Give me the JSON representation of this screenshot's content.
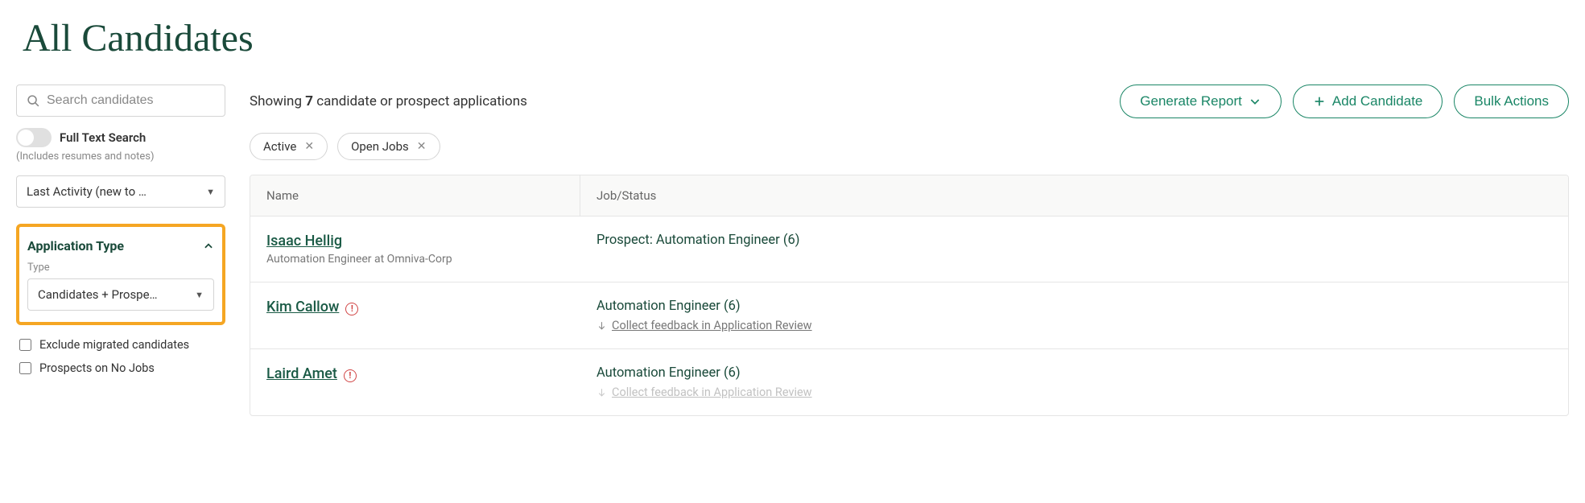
{
  "page_title": "All Candidates",
  "search_placeholder": "Search candidates",
  "full_text_search": {
    "label": "Full Text Search",
    "hint": "(Includes resumes and notes)"
  },
  "sort_select": "Last Activity (new to …",
  "application_type": {
    "header": "Application Type",
    "type_label": "Type",
    "type_value": "Candidates + Prospe…"
  },
  "checkboxes": {
    "exclude_migrated": "Exclude migrated candidates",
    "prospects_no_jobs": "Prospects on No Jobs"
  },
  "results": {
    "prefix": "Showing ",
    "count": "7",
    "suffix": " candidate or prospect applications"
  },
  "actions": {
    "generate_report": "Generate Report",
    "add_candidate": "Add Candidate",
    "bulk_actions": "Bulk Actions"
  },
  "chips": {
    "active": "Active",
    "open_jobs": "Open Jobs"
  },
  "columns": {
    "name": "Name",
    "job_status": "Job/Status"
  },
  "rows": [
    {
      "name": "Isaac Hellig",
      "subtitle": "Automation Engineer at Omniva-Corp",
      "alert": false,
      "job_status": "Prospect: Automation Engineer (6)",
      "feedback": ""
    },
    {
      "name": "Kim Callow",
      "subtitle": "",
      "alert": true,
      "job_status": "Automation Engineer (6)",
      "feedback": "Collect feedback in Application Review"
    },
    {
      "name": "Laird Amet",
      "subtitle": "",
      "alert": true,
      "job_status": "Automation Engineer (6)",
      "feedback": "Collect feedback in Application Review"
    }
  ]
}
